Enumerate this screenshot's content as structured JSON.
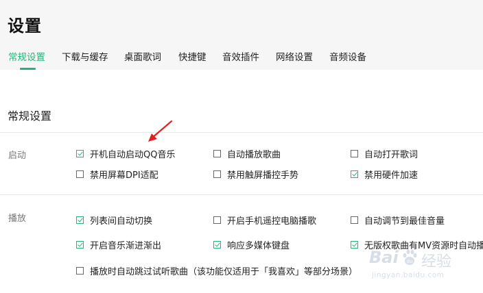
{
  "header": {
    "title": "设置",
    "tabs": [
      {
        "label": "常规设置",
        "active": true
      },
      {
        "label": "下载与缓存",
        "active": false
      },
      {
        "label": "桌面歌词",
        "active": false
      },
      {
        "label": "快捷键",
        "active": false
      },
      {
        "label": "音效插件",
        "active": false
      },
      {
        "label": "网络设置",
        "active": false
      },
      {
        "label": "音频设备",
        "active": false
      }
    ]
  },
  "section": {
    "title": "常规设置",
    "groups": [
      {
        "label": "启动",
        "options": [
          {
            "label": "开机自动启动QQ音乐",
            "checked": true
          },
          {
            "label": "自动播放歌曲",
            "checked": false
          },
          {
            "label": "自动打开歌词",
            "checked": false
          },
          {
            "label": "禁用屏幕DPI适配",
            "checked": false
          },
          {
            "label": "禁用触屏播控手势",
            "checked": false
          },
          {
            "label": "禁用硬件加速",
            "checked": true
          }
        ]
      },
      {
        "label": "播放",
        "options": [
          {
            "label": "列表间自动切换",
            "checked": true
          },
          {
            "label": "开启手机遥控电脑播歌",
            "checked": false
          },
          {
            "label": "自动调节到最佳音量",
            "checked": false
          },
          {
            "label": "开启音乐渐进渐出",
            "checked": true
          },
          {
            "label": "响应多媒体键盘",
            "checked": true
          },
          {
            "label": "无版权歌曲有MV资源时自动播",
            "checked": true
          },
          {
            "label": "播放时自动跳过试听歌曲（该功能仅适用于「我喜欢」等部分场景）",
            "checked": false
          }
        ]
      }
    ]
  },
  "annotation": {
    "arrow_color": "#e02020"
  },
  "watermark": {
    "brand": "Bai",
    "paw": "du",
    "suffix": "经验",
    "url": "jingyan.baidu.com"
  },
  "colors": {
    "accent": "#1fb67a",
    "header_bg": "#f6f6f6"
  }
}
